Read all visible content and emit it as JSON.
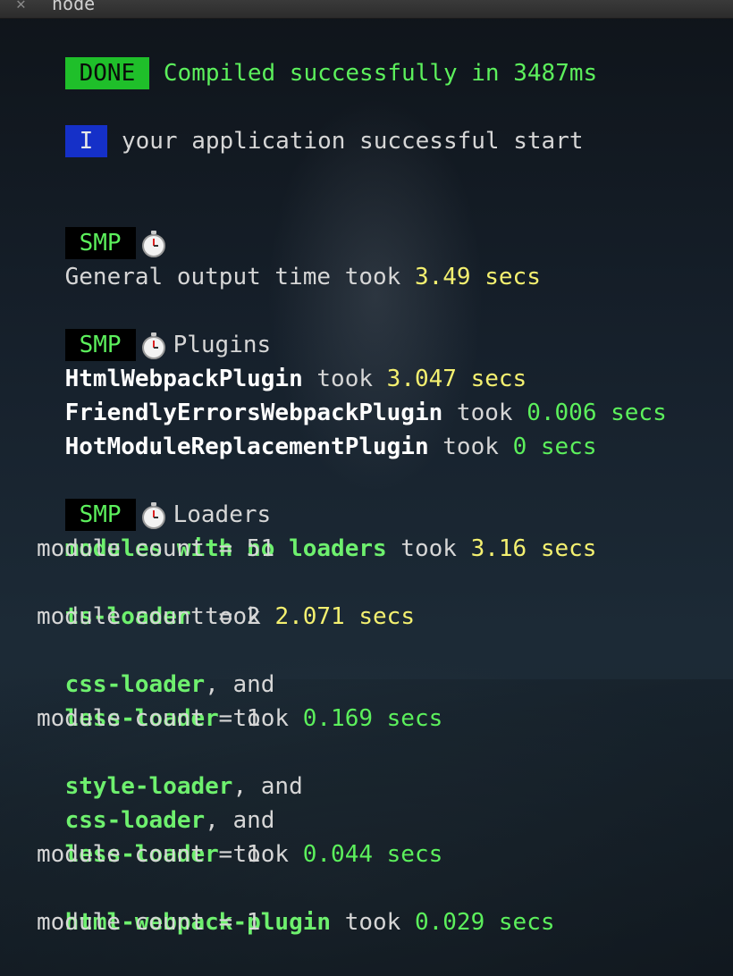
{
  "window": {
    "title": "node"
  },
  "status": {
    "done_badge": "DONE",
    "compiled_text": "Compiled successfully in 3487ms",
    "info_badge": "I",
    "info_text": "your application successful start"
  },
  "smp_label": "SMP",
  "general": {
    "text": "General output time took",
    "time": "3.49 secs"
  },
  "plugins": {
    "heading": "Plugins",
    "items": [
      {
        "name": "HtmlWebpackPlugin",
        "took": "took",
        "time": "3.047 secs"
      },
      {
        "name": "FriendlyErrorsWebpackPlugin",
        "took": "took",
        "time": "0.006 secs"
      },
      {
        "name": "HotModuleReplacementPlugin",
        "took": "took",
        "time": "0 secs"
      }
    ]
  },
  "loaders": {
    "heading": "Loaders",
    "lines": [
      {
        "name": "modules with no loaders",
        "suffix": " took ",
        "time": "3.16 secs"
      },
      {
        "count": "module count = 51"
      },
      {
        "name": "ts-loader",
        "suffix": " took ",
        "time": "2.071 secs"
      },
      {
        "count": "module count = 2"
      },
      {
        "name": "css-loader",
        "suffix": ", and"
      },
      {
        "name": "less-loader",
        "suffix": " took ",
        "time": "0.169 secs"
      },
      {
        "count": "module count = 1"
      },
      {
        "name": "style-loader",
        "suffix": ", and"
      },
      {
        "name": "css-loader",
        "suffix": ", and"
      },
      {
        "name": "less-loader",
        "suffix": " took ",
        "time": "0.044 secs"
      },
      {
        "count": "module count = 1"
      },
      {
        "name": "html-webpack-plugin",
        "suffix": " took ",
        "time": "0.029 secs"
      },
      {
        "count": "module count = 1"
      }
    ]
  },
  "colors": {
    "done_badge_bg": "#1fbf2a",
    "info_badge_bg": "#1530c8",
    "green_text": "#5cf05c",
    "yellow_time": "#f4f070"
  },
  "icons": {
    "stopwatch": "stopwatch-icon",
    "close": "close-icon"
  }
}
